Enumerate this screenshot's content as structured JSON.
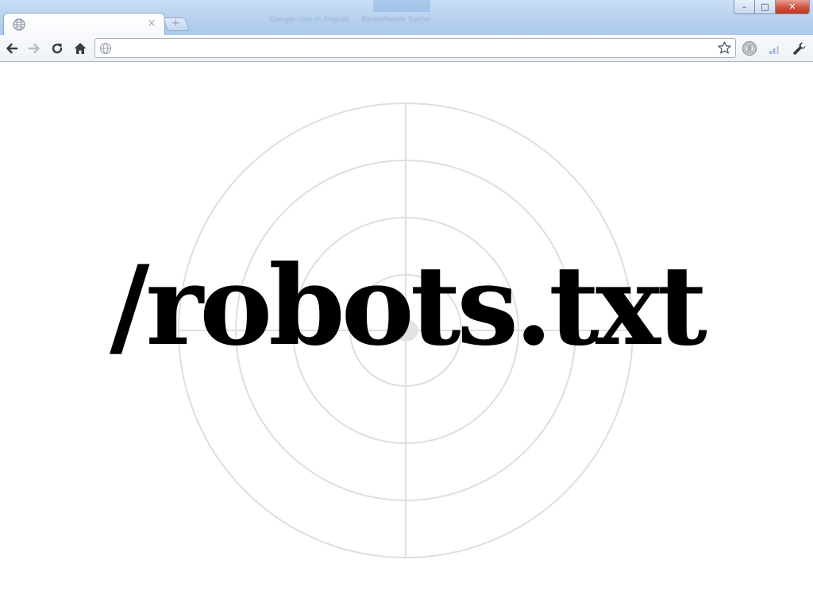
{
  "browser": {
    "tab": {
      "title": "",
      "favicon": "globe-icon",
      "close_glyph": "×"
    },
    "new_tab_glyph": "+",
    "window_controls": {
      "minimize_glyph": "–",
      "maximize_glyph": "□",
      "close_glyph": "✕"
    },
    "toolbar": {
      "back_icon": "back-arrow-icon",
      "forward_icon": "forward-arrow-icon",
      "reload_icon": "reload-icon",
      "home_icon": "home-icon",
      "bookmark_icon": "star-icon",
      "extension_icons": [
        "extension-icon",
        "signal-bars-icon"
      ],
      "menu_icon": "wrench-icon"
    },
    "omnibox": {
      "value": "",
      "placeholder": ""
    },
    "background_blur_texts": [
      "Google.com in English",
      "Einstellende Suche"
    ]
  },
  "page": {
    "headline": "/robots.txt",
    "target": {
      "ring_count": 4,
      "stroke_color": "#dedede",
      "center_dot_color": "#e3e3e3"
    }
  },
  "colors": {
    "titlebar": "#b7d1ee",
    "close_button": "#c9452c",
    "page_background": "#ffffff",
    "headline": "#000000"
  }
}
